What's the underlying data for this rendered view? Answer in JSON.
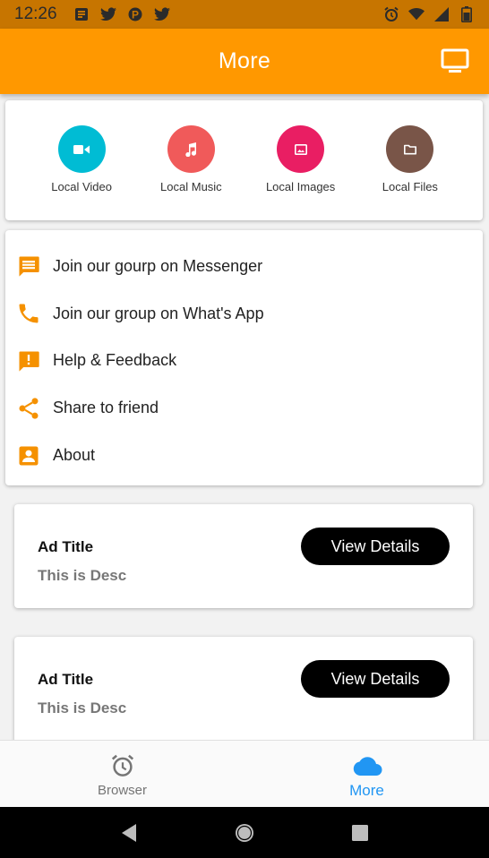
{
  "status_bar": {
    "time": "12:26",
    "left_icons": [
      "notes-icon",
      "twitter-icon",
      "pinterest-icon",
      "twitter-icon"
    ],
    "right_icons": [
      "alarm-icon",
      "wifi-icon",
      "signal-icon",
      "battery-icon"
    ]
  },
  "app_bar": {
    "title": "More",
    "action_icon": "cast-icon"
  },
  "quick_access": [
    {
      "label": "Local Video",
      "icon": "video-icon",
      "color": "#00bcd4"
    },
    {
      "label": "Local Music",
      "icon": "music-icon",
      "color": "#f05a5a"
    },
    {
      "label": "Local Images",
      "icon": "image-icon",
      "color": "#e91e63"
    },
    {
      "label": "Local Files",
      "icon": "folder-icon",
      "color": "#795548"
    }
  ],
  "menu": [
    {
      "label": "Join our gourp on Messenger",
      "icon": "message-icon"
    },
    {
      "label": "Join our group on What's App",
      "icon": "phone-icon"
    },
    {
      "label": "Help & Feedback",
      "icon": "feedback-icon"
    },
    {
      "label": "Share to friend",
      "icon": "share-icon"
    },
    {
      "label": "About",
      "icon": "account-box-icon"
    }
  ],
  "ads": [
    {
      "title": "Ad Title",
      "desc": "This is Desc",
      "button": "View Details"
    },
    {
      "title": "Ad Title",
      "desc": "This is Desc",
      "button": "View Details"
    }
  ],
  "bottom_nav": [
    {
      "label": "Browser",
      "icon": "alarm-clock-icon",
      "active": false
    },
    {
      "label": "More",
      "icon": "cloud-icon",
      "active": true
    }
  ],
  "colors": {
    "primary": "#ff9800",
    "status_bar": "#c77500",
    "accent_icon": "#f59100",
    "active_nav": "#2196f3"
  }
}
